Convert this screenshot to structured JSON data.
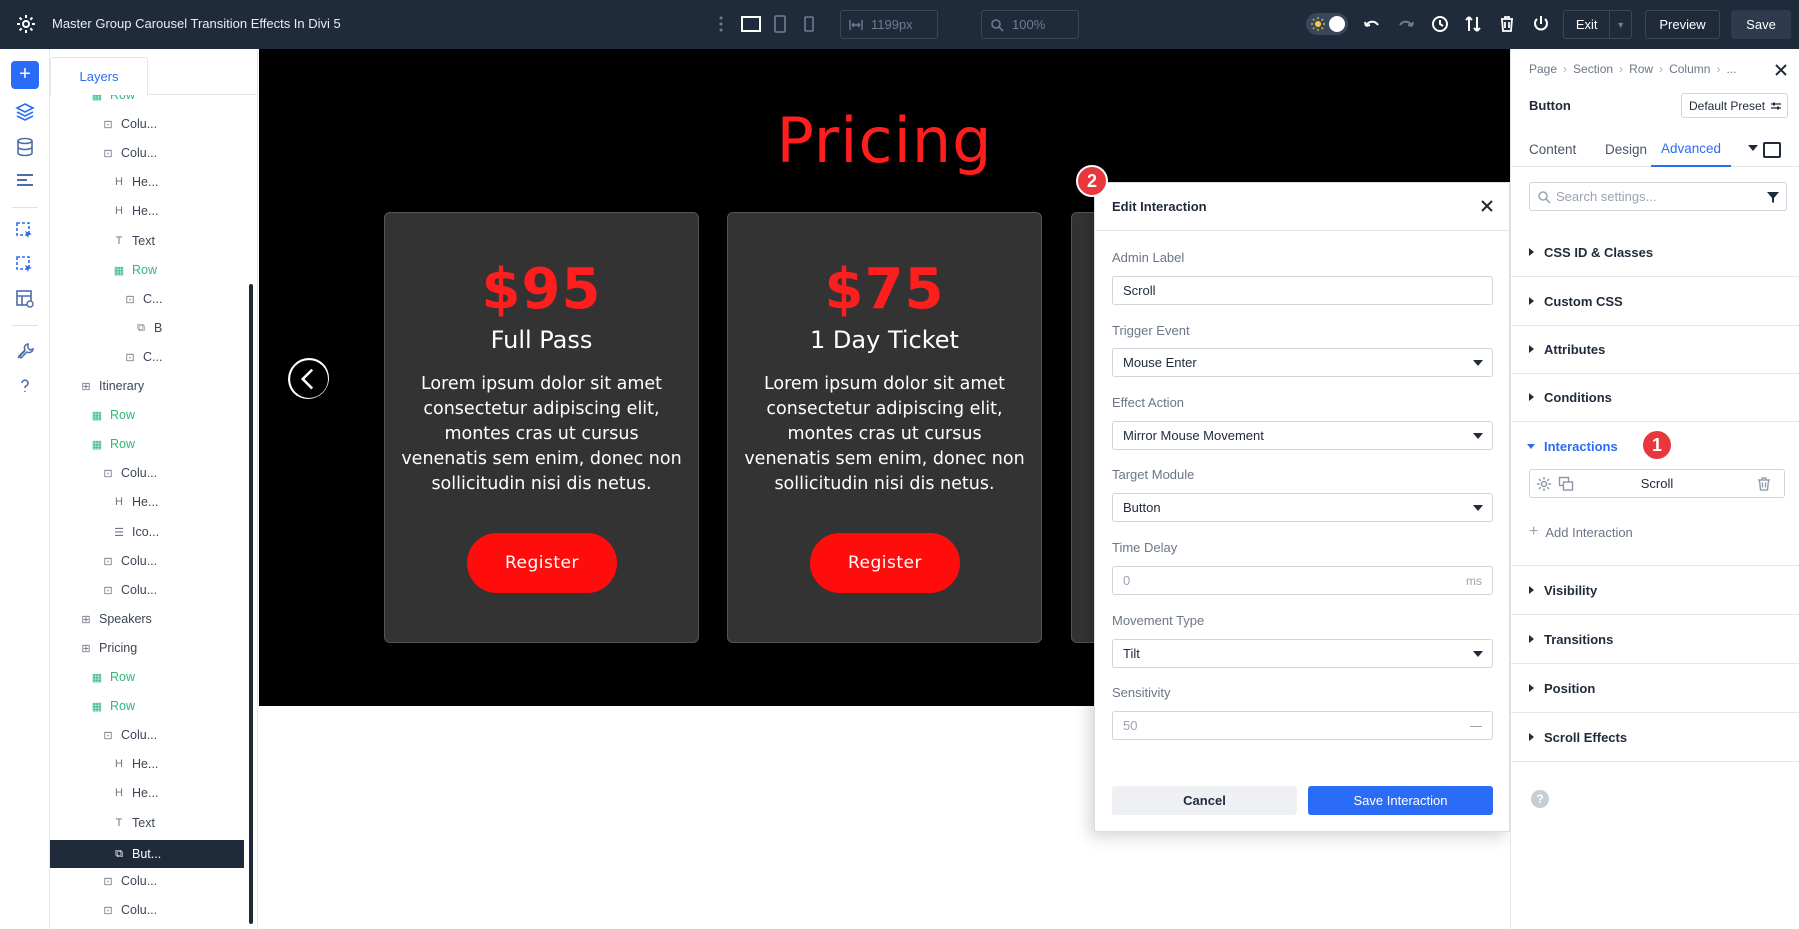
{
  "topbar": {
    "title": "Master Group Carousel Transition Effects In Divi 5",
    "width_value": "1199px",
    "zoom_value": "100%",
    "exit_label": "Exit",
    "preview_label": "Preview",
    "save_label": "Save"
  },
  "layers": {
    "tab_label": "Layers",
    "items": [
      {
        "label": "Row",
        "icon": "row-icon",
        "indent": 2,
        "green": true
      },
      {
        "label": "Colu...",
        "icon": "column-icon",
        "indent": 3,
        "green": false
      },
      {
        "label": "Colu...",
        "icon": "column-icon",
        "indent": 3,
        "green": false
      },
      {
        "label": "He...",
        "icon": "heading-icon",
        "indent": 4,
        "green": false
      },
      {
        "label": "He...",
        "icon": "heading-icon",
        "indent": 4,
        "green": false
      },
      {
        "label": "Text",
        "icon": "text-icon",
        "indent": 4,
        "green": false
      },
      {
        "label": "Row",
        "icon": "row-icon",
        "indent": 4,
        "green": true
      },
      {
        "label": "C...",
        "icon": "column-icon",
        "indent": 5,
        "green": false
      },
      {
        "label": "B",
        "icon": "button-icon",
        "indent": 6,
        "green": false
      },
      {
        "label": "C...",
        "icon": "column-icon",
        "indent": 5,
        "green": false
      },
      {
        "label": "Itinerary",
        "icon": "section-icon",
        "indent": 1,
        "green": false
      },
      {
        "label": "Row",
        "icon": "row-icon",
        "indent": 2,
        "green": true
      },
      {
        "label": "Row",
        "icon": "row-icon",
        "indent": 2,
        "green": true
      },
      {
        "label": "Colu...",
        "icon": "column-icon",
        "indent": 3,
        "green": false
      },
      {
        "label": "He...",
        "icon": "heading-icon",
        "indent": 4,
        "green": false
      },
      {
        "label": "Ico...",
        "icon": "icon-list-icon",
        "indent": 4,
        "green": false
      },
      {
        "label": "Colu...",
        "icon": "column-icon",
        "indent": 3,
        "green": false
      },
      {
        "label": "Colu...",
        "icon": "column-icon",
        "indent": 3,
        "green": false
      },
      {
        "label": "Speakers",
        "icon": "section-icon",
        "indent": 1,
        "green": false
      },
      {
        "label": "Pricing",
        "icon": "section-icon",
        "indent": 1,
        "green": false
      },
      {
        "label": "Row",
        "icon": "row-icon",
        "indent": 2,
        "green": true
      },
      {
        "label": "Row",
        "icon": "row-icon",
        "indent": 2,
        "green": true
      },
      {
        "label": "Colu...",
        "icon": "column-icon",
        "indent": 3,
        "green": false
      },
      {
        "label": "He...",
        "icon": "heading-icon",
        "indent": 4,
        "green": false
      },
      {
        "label": "He...",
        "icon": "heading-icon",
        "indent": 4,
        "green": false
      },
      {
        "label": "Text",
        "icon": "text-icon",
        "indent": 4,
        "green": false
      },
      {
        "label": "But...",
        "icon": "button-icon",
        "indent": 4,
        "green": false,
        "selected": true
      },
      {
        "label": "Colu...",
        "icon": "column-icon",
        "indent": 3,
        "green": false
      },
      {
        "label": "Colu...",
        "icon": "column-icon",
        "indent": 3,
        "green": false
      }
    ]
  },
  "canvas": {
    "heading": "Pricing",
    "cards": [
      {
        "price": "$95",
        "name": "Full Pass",
        "description": "Lorem ipsum dolor sit amet consectetur adipiscing elit, montes cras ut cursus venenatis sem enim, donec non sollicitudin nisi dis netus.",
        "button": "Register"
      },
      {
        "price": "$75",
        "name": "1 Day Ticket",
        "description": "Lorem ipsum dolor sit amet consectetur adipiscing elit, montes cras ut cursus venenatis sem enim, donec non sollicitudin nisi dis netus.",
        "button": "Register"
      }
    ]
  },
  "modal": {
    "title": "Edit Interaction",
    "badge": "2",
    "fields": {
      "admin_label": {
        "label": "Admin Label",
        "value": "Scroll"
      },
      "trigger_event": {
        "label": "Trigger Event",
        "value": "Mouse Enter"
      },
      "effect_action": {
        "label": "Effect Action",
        "value": "Mirror Mouse Movement"
      },
      "target_module": {
        "label": "Target Module",
        "value": "Button"
      },
      "time_delay": {
        "label": "Time Delay",
        "value": "0",
        "unit": "ms"
      },
      "movement_type": {
        "label": "Movement Type",
        "value": "Tilt"
      },
      "sensitivity": {
        "label": "Sensitivity",
        "value": "50"
      }
    },
    "cancel_label": "Cancel",
    "save_label": "Save Interaction"
  },
  "settings": {
    "breadcrumbs": [
      "Page",
      "Section",
      "Row",
      "Column",
      "..."
    ],
    "module_name": "Button",
    "preset_label": "Default Preset",
    "tabs": {
      "content": "Content",
      "design": "Design",
      "advanced": "Advanced"
    },
    "search_placeholder": "Search settings...",
    "groups": {
      "css_id": "CSS ID & Classes",
      "custom_css": "Custom CSS",
      "attributes": "Attributes",
      "conditions": "Conditions",
      "interactions": "Interactions",
      "visibility": "Visibility",
      "transitions": "Transitions",
      "position": "Position",
      "scroll_effects": "Scroll Effects"
    },
    "interaction_badge": "1",
    "interaction_item": "Scroll",
    "add_interaction": "Add Interaction",
    "help_label": "?"
  },
  "colors": {
    "accent": "#2b6cf6",
    "topbar": "#1f2a3b",
    "brand_red": "#ff1e1e",
    "layer_green": "#2fb77c",
    "badge_red": "#e8383d"
  }
}
